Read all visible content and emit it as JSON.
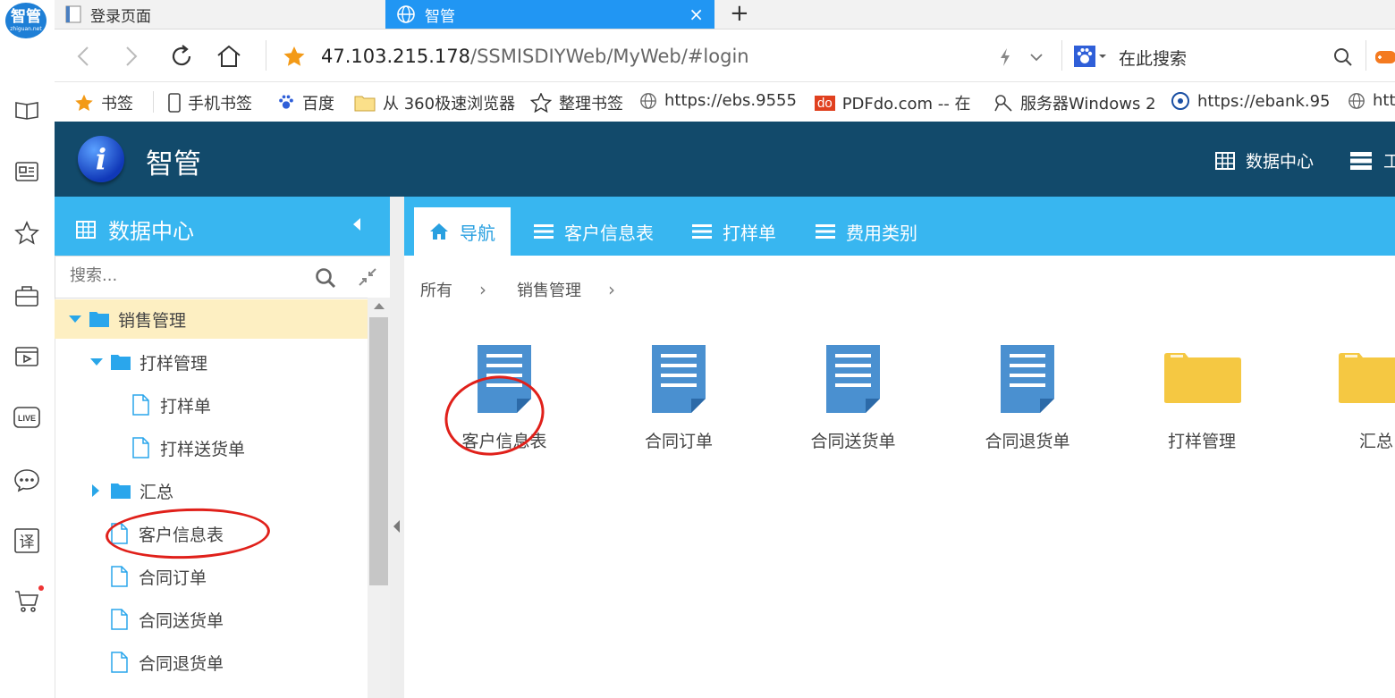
{
  "browser": {
    "rail_logo": "智管",
    "rail_logo_sub": "zhiguan.net",
    "tabs": [
      {
        "label": "登录页面"
      },
      {
        "label": "智管"
      }
    ],
    "url_host": "47.103.215.178",
    "url_path": "/SSMISDIYWeb/MyWeb/#login",
    "search_placeholder": "在此搜索",
    "bookmarks": [
      {
        "label": "书签",
        "icon": "star-icon"
      },
      {
        "label": "手机书签",
        "icon": "phone-icon"
      },
      {
        "label": "百度",
        "icon": "baidu-paw-icon"
      },
      {
        "label": "从 360极速浏览器",
        "icon": "folder-icon"
      },
      {
        "label": "整理书签",
        "icon": "star-outline-icon"
      },
      {
        "label": "https://ebs.9555",
        "icon": "globe-icon"
      },
      {
        "label": "PDFdo.com -- 在",
        "icon": "pdfdo-icon"
      },
      {
        "label": "服务器Windows 2",
        "icon": "server-icon"
      },
      {
        "label": "https://ebank.95",
        "icon": "bank-icon"
      },
      {
        "label": "htt",
        "icon": "globe-icon"
      }
    ],
    "rail_icons": [
      "book-icon",
      "news-icon",
      "star-outline-icon",
      "bag-icon",
      "video-icon",
      "live-icon",
      "chat-icon",
      "translate-icon",
      "cart-icon"
    ],
    "rail_live_text": "LIVE",
    "rail_translate_text": "译"
  },
  "app": {
    "title": "智管",
    "header_menu": [
      {
        "label": "数据中心",
        "icon": "grid-icon"
      },
      {
        "label": "工",
        "icon": "server-rack-icon"
      }
    ],
    "sidebar": {
      "title": "数据中心",
      "search_placeholder": "搜索...",
      "tree": [
        {
          "label": "销售管理",
          "type": "folder",
          "expanded": true,
          "selected": true
        },
        {
          "label": "打样管理",
          "type": "folder",
          "expanded": true
        },
        {
          "label": "打样单",
          "type": "file"
        },
        {
          "label": "打样送货单",
          "type": "file"
        },
        {
          "label": "汇总",
          "type": "folder",
          "expanded": false
        },
        {
          "label": "客户信息表",
          "type": "file",
          "highlighted": true
        },
        {
          "label": "合同订单",
          "type": "file"
        },
        {
          "label": "合同送货单",
          "type": "file"
        },
        {
          "label": "合同退货单",
          "type": "file"
        }
      ]
    },
    "main_tabs": [
      {
        "label": "导航",
        "icon": "home-icon",
        "active": true
      },
      {
        "label": "客户信息表",
        "icon": "list-icon"
      },
      {
        "label": "打样单",
        "icon": "list-icon"
      },
      {
        "label": "费用类别",
        "icon": "list-icon"
      }
    ],
    "breadcrumb": [
      "所有",
      "销售管理"
    ],
    "tiles": [
      {
        "label": "客户信息表",
        "type": "document",
        "highlighted": true
      },
      {
        "label": "合同订单",
        "type": "document"
      },
      {
        "label": "合同送货单",
        "type": "document"
      },
      {
        "label": "合同退货单",
        "type": "document"
      },
      {
        "label": "打样管理",
        "type": "folder"
      },
      {
        "label": "汇总",
        "type": "folder"
      }
    ]
  },
  "colors": {
    "header_bg": "#124a6b",
    "accent_blue": "#38b6f0",
    "tab_active": "#2196f3",
    "doc_blue": "#4a90d0",
    "folder_yellow": "#f5c842",
    "annotation_red": "#e0201a",
    "selection_bg": "#fdefc2"
  }
}
